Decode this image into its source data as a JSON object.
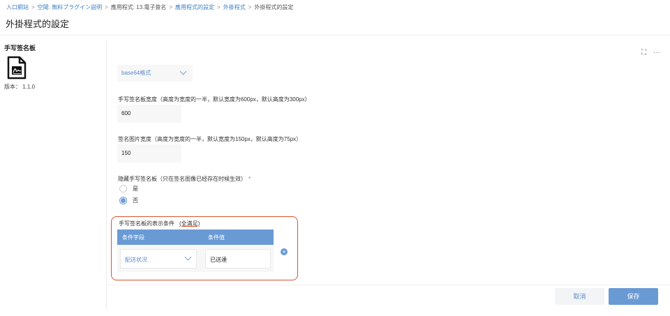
{
  "breadcrumb": {
    "items": [
      "入口網站",
      "空間: 無料プラグイン説明",
      "應用程式: 13.電子簽名",
      "應用程式的設定",
      "外掛程式",
      "外掛程式的設定"
    ],
    "separator": ">"
  },
  "page_title": "外掛程式的設定",
  "plugin": {
    "name": "手写签名板",
    "icon": "signature-document-icon",
    "version": "版本： 1.1.0"
  },
  "panel_tools": {
    "expand": "⛶",
    "more": "···"
  },
  "form": {
    "format_select": {
      "value": "base64格式"
    },
    "board_width": {
      "label": "手写签名板宽度（高度为宽度的一半，默认宽度为600px，默认高度为300px）",
      "value": "600"
    },
    "image_width": {
      "label": "签名图片宽度（高度为宽度的一半，默认宽度为150px，默认高度为75px）",
      "value": "150"
    },
    "hide_board": {
      "label": "隐藏手写签名板（只在签名图像已经存在时候生效）",
      "required_mark": "*",
      "options": [
        {
          "label": "是",
          "checked": false
        },
        {
          "label": "否",
          "checked": true
        }
      ]
    },
    "display_condition": {
      "label": "手写签名板的表示条件",
      "mode": "(全満足)",
      "columns": [
        "条件字段",
        "条件值"
      ],
      "rows": [
        {
          "field": "配送状况",
          "value": "已送達"
        }
      ],
      "add_label": "+"
    }
  },
  "footer": {
    "cancel_label": "取消",
    "save_label": "保存"
  },
  "colors": {
    "accent": "#6a9ad4",
    "link": "#3b7fc4",
    "highlight": "#d9552e"
  }
}
